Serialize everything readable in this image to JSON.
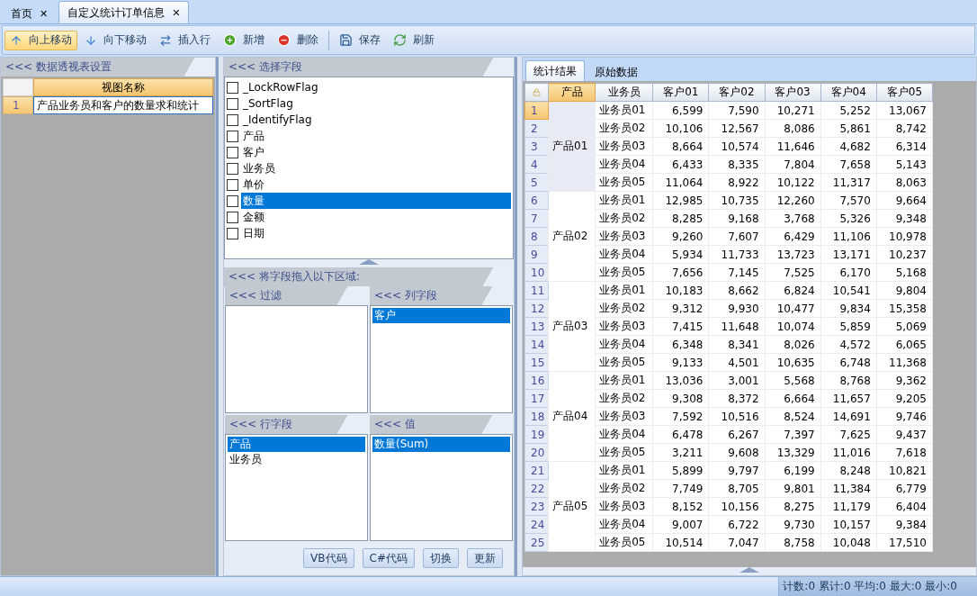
{
  "doc_tabs": [
    {
      "label": "首页",
      "close": "✕",
      "selected": false
    },
    {
      "label": "自定义统计订单信息",
      "close": "✕",
      "selected": true
    }
  ],
  "toolbar": [
    {
      "kind": "up",
      "label": "向上移动",
      "selected": true
    },
    {
      "kind": "down",
      "label": "向下移动",
      "selected": false
    },
    {
      "kind": "insert",
      "label": "插入行",
      "selected": false
    },
    {
      "kind": "add",
      "label": "新增",
      "selected": false
    },
    {
      "kind": "delete",
      "label": "删除",
      "selected": false
    },
    {
      "kind": "save",
      "label": "保存",
      "selected": false
    },
    {
      "kind": "refresh",
      "label": "刷新",
      "selected": false
    }
  ],
  "settings_panel": {
    "title": "<<< 数据透视表设置",
    "column": "视图名称",
    "rows": [
      {
        "num": "1",
        "name": "产品业务员和客户的数量求和统计",
        "selected": true
      }
    ]
  },
  "field_panel": {
    "title": "<<< 选择字段",
    "fields": [
      {
        "label": "_LockRowFlag",
        "checked": false,
        "selected": false
      },
      {
        "label": "_SortFlag",
        "checked": false,
        "selected": false
      },
      {
        "label": "_IdentifyFlag",
        "checked": false,
        "selected": false
      },
      {
        "label": "产品",
        "checked": false,
        "selected": false
      },
      {
        "label": "客户",
        "checked": false,
        "selected": false
      },
      {
        "label": "业务员",
        "checked": false,
        "selected": false
      },
      {
        "label": "单价",
        "checked": false,
        "selected": false
      },
      {
        "label": "数量",
        "checked": false,
        "selected": true
      },
      {
        "label": "金额",
        "checked": false,
        "selected": false
      },
      {
        "label": "日期",
        "checked": false,
        "selected": false
      }
    ],
    "drop_title": "<<< 将字段拖入以下区域:",
    "zones": [
      {
        "title": "<<< 过滤"
      },
      {
        "title": "<<< 列字段",
        "items": [
          {
            "label": "客户",
            "selected": true
          }
        ]
      },
      {
        "title": "<<< 行字段",
        "items": [
          {
            "label": "产品",
            "selected": true
          },
          {
            "label": "业务员",
            "selected": false
          }
        ]
      },
      {
        "title": "<<< 值",
        "items": [
          {
            "label": "数量(Sum)",
            "selected": true
          }
        ]
      }
    ],
    "buttons": [
      "VB代码",
      "C#代码",
      "切换",
      "更新"
    ]
  },
  "result_tabs": [
    {
      "label": "统计结果",
      "selected": true
    },
    {
      "label": "原始数据",
      "selected": false
    }
  ],
  "table": {
    "columns": [
      "产品",
      "业务员",
      "客户01",
      "客户02",
      "客户03",
      "客户04",
      "客户05"
    ],
    "groups": [
      {
        "product": "产品01",
        "highlighted": true,
        "rows": [
          {
            "num": "1",
            "selected": true,
            "salesperson": "业务员01",
            "values": [
              "6,599",
              "7,590",
              "10,271",
              "5,252",
              "13,067"
            ]
          },
          {
            "num": "2",
            "selected": false,
            "salesperson": "业务员02",
            "values": [
              "10,106",
              "12,567",
              "8,086",
              "5,861",
              "8,742"
            ]
          },
          {
            "num": "3",
            "selected": false,
            "salesperson": "业务员03",
            "values": [
              "8,664",
              "10,574",
              "11,646",
              "4,682",
              "6,314"
            ]
          },
          {
            "num": "4",
            "selected": false,
            "salesperson": "业务员04",
            "values": [
              "6,433",
              "8,335",
              "7,804",
              "7,658",
              "5,143"
            ]
          },
          {
            "num": "5",
            "selected": false,
            "salesperson": "业务员05",
            "values": [
              "11,064",
              "8,922",
              "10,122",
              "11,317",
              "8,063"
            ]
          }
        ]
      },
      {
        "product": "产品02",
        "highlighted": false,
        "rows": [
          {
            "num": "6",
            "selected": false,
            "salesperson": "业务员01",
            "values": [
              "12,985",
              "10,735",
              "12,260",
              "7,570",
              "9,664"
            ]
          },
          {
            "num": "7",
            "selected": false,
            "salesperson": "业务员02",
            "values": [
              "8,285",
              "9,168",
              "3,768",
              "5,326",
              "9,348"
            ]
          },
          {
            "num": "8",
            "selected": false,
            "salesperson": "业务员03",
            "values": [
              "9,260",
              "7,607",
              "6,429",
              "11,106",
              "10,978"
            ]
          },
          {
            "num": "9",
            "selected": false,
            "salesperson": "业务员04",
            "values": [
              "5,934",
              "11,733",
              "13,723",
              "13,171",
              "10,237"
            ]
          },
          {
            "num": "10",
            "selected": false,
            "salesperson": "业务员05",
            "values": [
              "7,656",
              "7,145",
              "7,525",
              "6,170",
              "5,168"
            ]
          }
        ]
      },
      {
        "product": "产品03",
        "highlighted": false,
        "rows": [
          {
            "num": "11",
            "selected": false,
            "salesperson": "业务员01",
            "values": [
              "10,183",
              "8,662",
              "6,824",
              "10,541",
              "9,804"
            ]
          },
          {
            "num": "12",
            "selected": false,
            "salesperson": "业务员02",
            "values": [
              "9,312",
              "9,930",
              "10,477",
              "9,834",
              "15,358"
            ]
          },
          {
            "num": "13",
            "selected": false,
            "salesperson": "业务员03",
            "values": [
              "7,415",
              "11,648",
              "10,074",
              "5,859",
              "5,069"
            ]
          },
          {
            "num": "14",
            "selected": false,
            "salesperson": "业务员04",
            "values": [
              "6,348",
              "8,341",
              "8,026",
              "4,572",
              "6,065"
            ]
          },
          {
            "num": "15",
            "selected": false,
            "salesperson": "业务员05",
            "values": [
              "9,133",
              "4,501",
              "10,635",
              "6,748",
              "11,368"
            ]
          }
        ]
      },
      {
        "product": "产品04",
        "highlighted": false,
        "rows": [
          {
            "num": "16",
            "selected": false,
            "salesperson": "业务员01",
            "values": [
              "13,036",
              "3,001",
              "5,568",
              "8,768",
              "9,362"
            ]
          },
          {
            "num": "17",
            "selected": false,
            "salesperson": "业务员02",
            "values": [
              "9,308",
              "8,372",
              "6,664",
              "11,657",
              "9,205"
            ]
          },
          {
            "num": "18",
            "selected": false,
            "salesperson": "业务员03",
            "values": [
              "7,592",
              "10,516",
              "8,524",
              "14,691",
              "9,746"
            ]
          },
          {
            "num": "19",
            "selected": false,
            "salesperson": "业务员04",
            "values": [
              "6,478",
              "6,267",
              "7,397",
              "7,625",
              "9,437"
            ]
          },
          {
            "num": "20",
            "selected": false,
            "salesperson": "业务员05",
            "values": [
              "3,211",
              "9,608",
              "13,329",
              "11,016",
              "7,618"
            ]
          }
        ]
      },
      {
        "product": "产品05",
        "highlighted": false,
        "rows": [
          {
            "num": "21",
            "selected": false,
            "salesperson": "业务员01",
            "values": [
              "5,899",
              "9,797",
              "6,199",
              "8,248",
              "10,821"
            ]
          },
          {
            "num": "22",
            "selected": false,
            "salesperson": "业务员02",
            "values": [
              "7,749",
              "8,705",
              "9,801",
              "11,384",
              "6,779"
            ]
          },
          {
            "num": "23",
            "selected": false,
            "salesperson": "业务员03",
            "values": [
              "8,152",
              "10,156",
              "8,275",
              "11,179",
              "6,404"
            ]
          },
          {
            "num": "24",
            "selected": false,
            "salesperson": "业务员04",
            "values": [
              "9,007",
              "6,722",
              "9,730",
              "10,157",
              "9,384"
            ]
          },
          {
            "num": "25",
            "selected": false,
            "salesperson": "业务员05",
            "values": [
              "10,514",
              "7,047",
              "8,758",
              "10,048",
              "17,510"
            ]
          }
        ]
      }
    ]
  },
  "status_bar": "计数:0 累计:0 平均:0 最大:0 最小:0"
}
